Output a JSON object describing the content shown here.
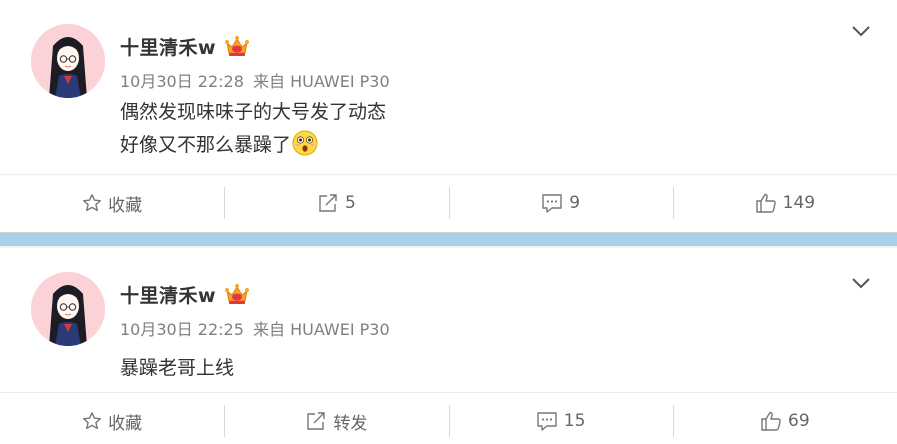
{
  "posts": [
    {
      "username": "十里清禾w",
      "date": "10月30日 22:28",
      "source": "来自 HUAWEI P30",
      "lines": [
        "偶然发现味味子的大号发了动态",
        "好像又不那么暴躁了"
      ],
      "actions": {
        "favorite": "收藏",
        "repost": "5",
        "comment": "9",
        "like": "149"
      }
    },
    {
      "username": "十里清禾w",
      "date": "10月30日 22:25",
      "source": "来自 HUAWEI P30",
      "lines": [
        "暴躁老哥上线"
      ],
      "actions": {
        "favorite": "收藏",
        "repost": "转发",
        "comment": "15",
        "like": "69"
      }
    }
  ],
  "icons": {
    "favorite": "star-outline-icon",
    "repost": "share-arrow-icon",
    "comment": "comment-icon",
    "like": "thumbs-up-icon",
    "menu": "chevron-down-icon",
    "badge": "vip-crown-badge-icon",
    "emoji": "surprised-face-emoji-icon"
  },
  "colors": {
    "divider_strip": "#a8d1e9",
    "avatar_bg": "#fbd3d6",
    "text_primary": "#333333",
    "text_meta": "#808080"
  }
}
